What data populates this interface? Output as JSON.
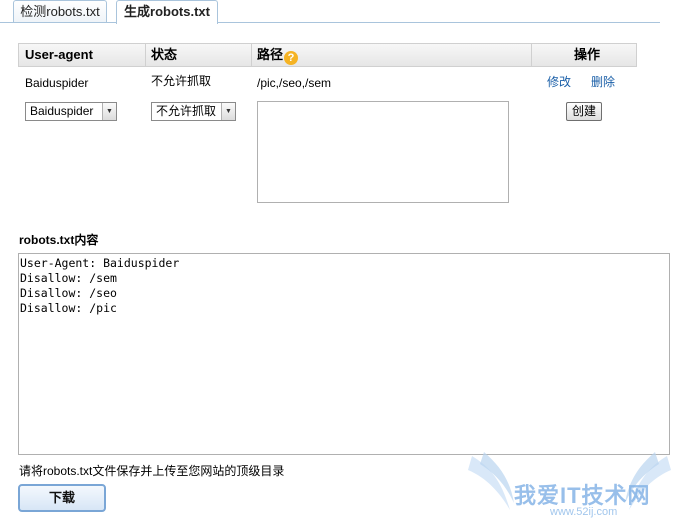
{
  "tabs": [
    {
      "label": "检测robots.txt",
      "active": false
    },
    {
      "label": "生成robots.txt",
      "active": true
    }
  ],
  "table": {
    "headers": {
      "user_agent": "User-agent",
      "status": "状态",
      "path": "路径",
      "actions": "操作"
    },
    "rows": [
      {
        "user_agent": "Baiduspider",
        "status": "不允许抓取",
        "path": "/pic,/seo,/sem",
        "edit": "修改",
        "delete": "删除"
      }
    ]
  },
  "form": {
    "user_agent_select": "Baiduspider",
    "status_select": "不允许抓取",
    "path_value": "",
    "create_label": "创建"
  },
  "content": {
    "title": "robots.txt内容",
    "lines": [
      "User-Agent: Baiduspider",
      "Disallow: /sem",
      "Disallow: /seo",
      "Disallow: /pic"
    ]
  },
  "hint": "请将robots.txt文件保存并上传至您网站的顶级目录",
  "download_label": "下载",
  "watermark": {
    "text": "我爱IT技术网",
    "url": "www.52ij.com"
  },
  "colors": {
    "link": "#1a5fa8",
    "tab_border": "#a9c4dc",
    "help_icon": "#f5b324"
  }
}
